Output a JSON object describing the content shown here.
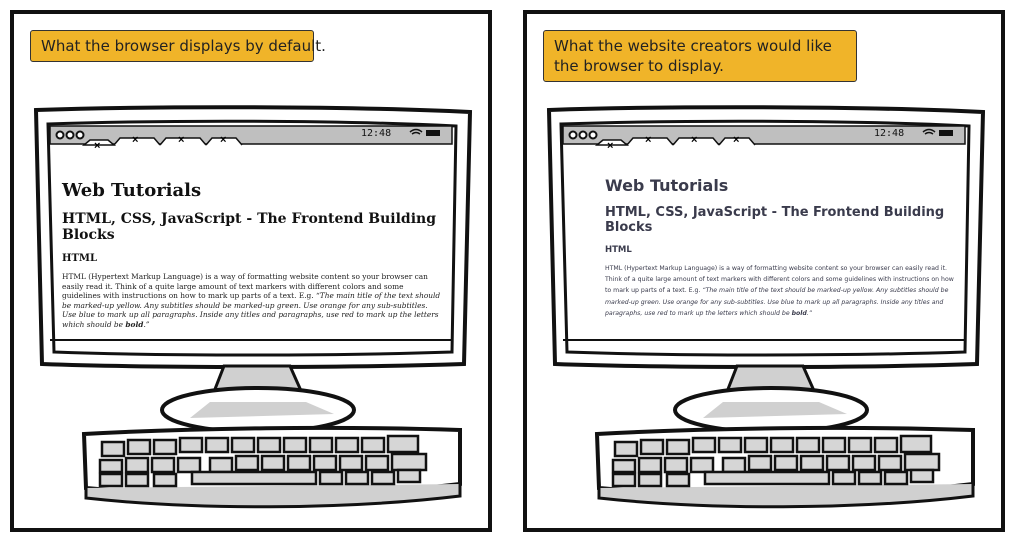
{
  "left_panel": {
    "caption": "What the browser displays by default."
  },
  "right_panel": {
    "caption": "What the website creators would like the browser to display."
  },
  "browser": {
    "clock": "12:48",
    "tab_close": "×"
  },
  "page": {
    "title": "Web Tutorials",
    "subtitle": "HTML, CSS, JavaScript - The Frontend Building Blocks",
    "section_heading": "HTML",
    "para_plain": "HTML (Hypertext Markup Language) is a way of formatting website content so your browser can easily read it. Think of a quite large amount of text markers with different colors and some guidelines with instructions on how to mark up parts of a text. E.g. ",
    "para_italic_1": "“The main title of the text should be marked-up yellow. Any subtitles should be marked-up green. Use orange for any sub-subtitles. Use blue to mark up all paragraphs. Inside any titles and paragraphs, use red to mark up the letters which should be ",
    "para_bold": "bold",
    "para_italic_2": ".”"
  }
}
